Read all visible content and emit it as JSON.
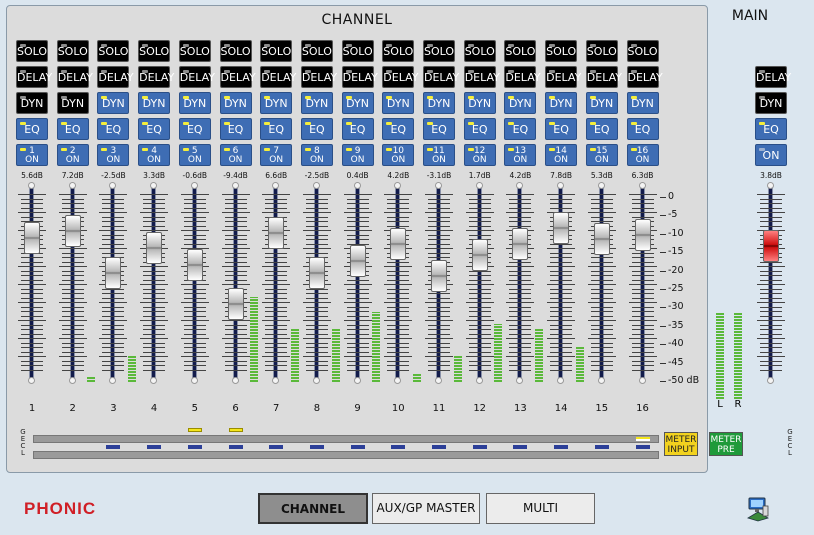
{
  "panel": {
    "title": "CHANNEL"
  },
  "main": {
    "title": "MAIN",
    "delay_label": "DELAY",
    "dyn_label": "DYN",
    "eq_label": "EQ",
    "on_label": "ON",
    "db_value": "3.8dB",
    "fader_db": 3.8,
    "meter_l": "L",
    "meter_r": "R",
    "level_l": 0.48,
    "level_r": 0.48,
    "fader_color": "#d01010"
  },
  "buttons": {
    "solo": "SOLO",
    "delay": "DELAY",
    "dyn": "DYN",
    "eq": "EQ",
    "on": "ON"
  },
  "channels": [
    {
      "num": "1",
      "db": "5.6dB",
      "fader_db": 5.6,
      "meter": 0.0,
      "dyn_active": false,
      "eq_led": true,
      "on_led": true
    },
    {
      "num": "2",
      "db": "7.2dB",
      "fader_db": 7.2,
      "meter": 0.0,
      "dyn_active": false,
      "eq_led": true,
      "on_led": true
    },
    {
      "num": "3",
      "db": "-2.5dB",
      "fader_db": -2.5,
      "meter": 0.03,
      "dyn_active": true,
      "eq_led": true,
      "on_led": true
    },
    {
      "num": "4",
      "db": "3.3dB",
      "fader_db": 3.3,
      "meter": 0.15,
      "dyn_active": true,
      "eq_led": true,
      "on_led": true
    },
    {
      "num": "5",
      "db": "-0.6dB",
      "fader_db": -0.6,
      "meter": 0.0,
      "dyn_active": true,
      "eq_led": true,
      "on_led": true
    },
    {
      "num": "6",
      "db": "-9.4dB",
      "fader_db": -9.4,
      "meter": 0.0,
      "dyn_active": true,
      "eq_led": true,
      "on_led": true
    },
    {
      "num": "7",
      "db": "6.6dB",
      "fader_db": 6.6,
      "meter": 0.47,
      "dyn_active": true,
      "eq_led": true,
      "on_led": true
    },
    {
      "num": "8",
      "db": "-2.5dB",
      "fader_db": -2.5,
      "meter": 0.3,
      "dyn_active": true,
      "eq_led": true,
      "on_led": true
    },
    {
      "num": "9",
      "db": "0.4dB",
      "fader_db": 0.4,
      "meter": 0.3,
      "dyn_active": true,
      "eq_led": true,
      "on_led": true
    },
    {
      "num": "10",
      "db": "4.2dB",
      "fader_db": 4.2,
      "meter": 0.39,
      "dyn_active": true,
      "eq_led": true,
      "on_led": true
    },
    {
      "num": "11",
      "db": "-3.1dB",
      "fader_db": -3.1,
      "meter": 0.05,
      "dyn_active": true,
      "eq_led": true,
      "on_led": true
    },
    {
      "num": "12",
      "db": "1.7dB",
      "fader_db": 1.7,
      "meter": 0.15,
      "dyn_active": true,
      "eq_led": true,
      "on_led": true
    },
    {
      "num": "13",
      "db": "4.2dB",
      "fader_db": 4.2,
      "meter": 0.32,
      "dyn_active": true,
      "eq_led": true,
      "on_led": true
    },
    {
      "num": "14",
      "db": "7.8dB",
      "fader_db": 7.8,
      "meter": 0.3,
      "dyn_active": true,
      "eq_led": true,
      "on_led": true
    },
    {
      "num": "15",
      "db": "5.3dB",
      "fader_db": 5.3,
      "meter": 0.2,
      "dyn_active": true,
      "eq_led": true,
      "on_led": true
    },
    {
      "num": "16",
      "db": "6.3dB",
      "fader_db": 6.3,
      "meter": 0.0,
      "dyn_active": true,
      "eq_led": true,
      "on_led": true
    }
  ],
  "scale": [
    "0",
    "-5",
    "-10",
    "-15",
    "-20",
    "-25",
    "-30",
    "-35",
    "-40",
    "-45",
    "-50 dB"
  ],
  "bus": {
    "gecl": [
      "G",
      "E",
      "C",
      "L"
    ],
    "top_active_channels": [
      5,
      6
    ],
    "bottom_active_channels": [
      3,
      4,
      5,
      6,
      7,
      8,
      9,
      10,
      11,
      12,
      13,
      14,
      15,
      16
    ],
    "channel16_top_white": true,
    "meter_input_label": [
      "METER",
      "INPUT"
    ],
    "meter_pre_label": [
      "METER",
      "PRE"
    ],
    "meter_input_color": "#f2d21e",
    "meter_pre_color": "#1f9a3a"
  },
  "tabs": [
    {
      "label": "CHANNEL",
      "active": true
    },
    {
      "label": "AUX/GP MASTER",
      "active": false
    },
    {
      "label": "MULTI",
      "active": false
    }
  ],
  "logo": "PHONIC",
  "icons": {
    "network": "network-computer-icon"
  }
}
